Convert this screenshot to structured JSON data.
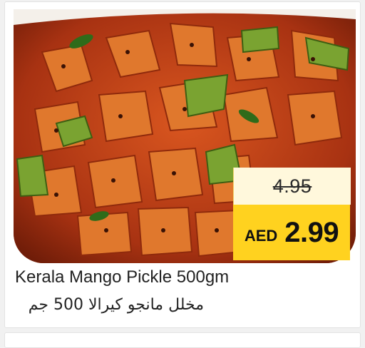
{
  "product": {
    "name_en": "Kerala Mango Pickle 500gm",
    "name_ar": "مخلل مانجو كيرالا 500 جم",
    "image_alt": "Kerala Mango Pickle"
  },
  "pricing": {
    "old_price": "4.95",
    "currency": "AED",
    "new_price": "2.99"
  },
  "colors": {
    "price_badge": "#ffd21f",
    "old_price_bg": "#fff8dc",
    "pickle_red": "#c7441a"
  }
}
